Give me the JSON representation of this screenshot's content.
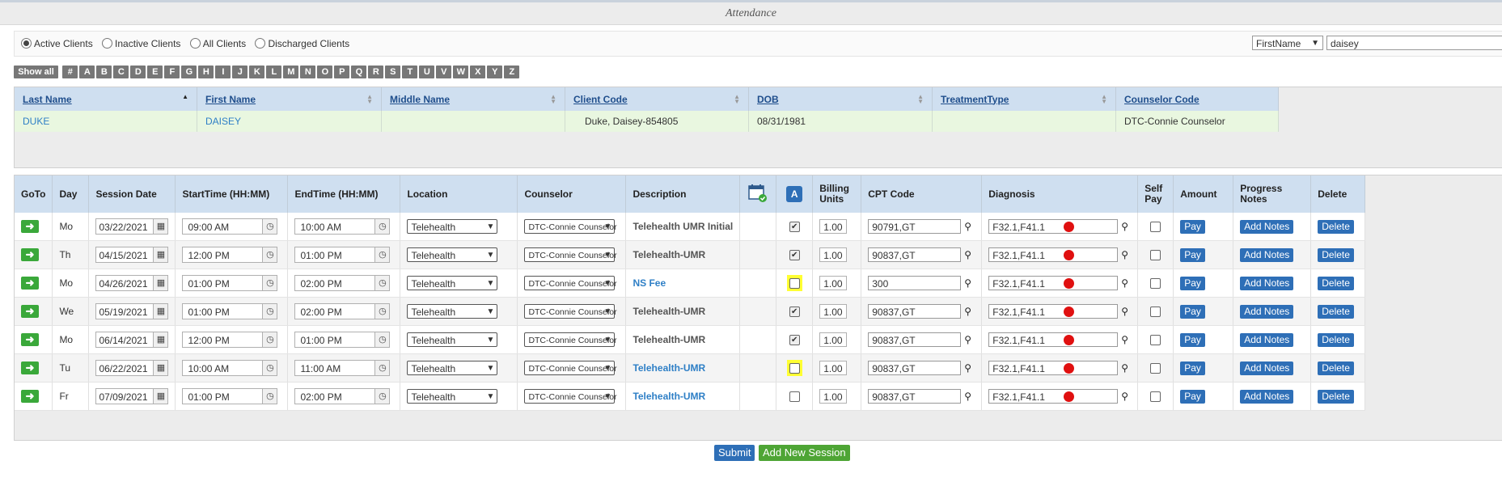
{
  "page": {
    "title": "Attendance"
  },
  "filters": {
    "radios": [
      {
        "label": "Active Clients",
        "checked": true
      },
      {
        "label": "Inactive Clients",
        "checked": false
      },
      {
        "label": "All Clients",
        "checked": false
      },
      {
        "label": "Discharged Clients",
        "checked": false
      }
    ],
    "search_field": "FirstName",
    "search_value": "daisey"
  },
  "alphabet": {
    "show_all": "Show all",
    "letters": [
      "#",
      "A",
      "B",
      "C",
      "D",
      "E",
      "F",
      "G",
      "H",
      "I",
      "J",
      "K",
      "L",
      "M",
      "N",
      "O",
      "P",
      "Q",
      "R",
      "S",
      "T",
      "U",
      "V",
      "W",
      "X",
      "Y",
      "Z"
    ]
  },
  "clients": {
    "headers": [
      "Last Name",
      "First Name",
      "Middle Name",
      "Client Code",
      "DOB",
      "TreatmentType",
      "Counselor Code"
    ],
    "rows": [
      {
        "last": "DUKE",
        "first": "DAISEY",
        "middle": "",
        "code": "Duke, Daisey-854805",
        "dob": "08/31/1981",
        "treatment": "",
        "counselor": "DTC-Connie Counselor"
      }
    ]
  },
  "sessions": {
    "headers": {
      "goto": "GoTo",
      "day": "Day",
      "date": "Session Date",
      "start": "StartTime (HH:MM)",
      "end": "EndTime (HH:MM)",
      "location": "Location",
      "counselor": "Counselor",
      "description": "Description",
      "attend": "A",
      "units_1": "Billing",
      "units_2": "Units",
      "cpt": "CPT Code",
      "diagnosis": "Diagnosis",
      "selfpay_1": "Self",
      "selfpay_2": "Pay",
      "amount": "Amount",
      "notes_1": "Progress",
      "notes_2": "Notes",
      "delete": "Delete"
    },
    "rows": [
      {
        "day": "Mo",
        "date": "03/22/2021",
        "start": "09:00 AM",
        "end": "10:00 AM",
        "location": "Telehealth",
        "counselor": "DTC-Connie Counselor",
        "description": "Telehealth UMR Initial",
        "desc_link": false,
        "attended": true,
        "highlight": false,
        "units": "1.00",
        "cpt": "90791,GT",
        "diagnosis": "F32.1,F41.1",
        "pay": "Pay",
        "notes": "Add Notes",
        "delete": "Delete"
      },
      {
        "day": "Th",
        "date": "04/15/2021",
        "start": "12:00 PM",
        "end": "01:00 PM",
        "location": "Telehealth",
        "counselor": "DTC-Connie Counselor",
        "description": "Telehealth-UMR",
        "desc_link": false,
        "attended": true,
        "highlight": false,
        "units": "1.00",
        "cpt": "90837,GT",
        "diagnosis": "F32.1,F41.1",
        "pay": "Pay",
        "notes": "Add Notes",
        "delete": "Delete"
      },
      {
        "day": "Mo",
        "date": "04/26/2021",
        "start": "01:00 PM",
        "end": "02:00 PM",
        "location": "Telehealth",
        "counselor": "DTC-Connie Counselor",
        "description": "NS Fee",
        "desc_link": true,
        "attended": false,
        "highlight": true,
        "units": "1.00",
        "cpt": "300",
        "diagnosis": "F32.1,F41.1",
        "pay": "Pay",
        "notes": "Add Notes",
        "delete": "Delete"
      },
      {
        "day": "We",
        "date": "05/19/2021",
        "start": "01:00 PM",
        "end": "02:00 PM",
        "location": "Telehealth",
        "counselor": "DTC-Connie Counselor",
        "description": "Telehealth-UMR",
        "desc_link": false,
        "attended": true,
        "highlight": false,
        "units": "1.00",
        "cpt": "90837,GT",
        "diagnosis": "F32.1,F41.1",
        "pay": "Pay",
        "notes": "Add Notes",
        "delete": "Delete"
      },
      {
        "day": "Mo",
        "date": "06/14/2021",
        "start": "12:00 PM",
        "end": "01:00 PM",
        "location": "Telehealth",
        "counselor": "DTC-Connie Counselor",
        "description": "Telehealth-UMR",
        "desc_link": false,
        "attended": true,
        "highlight": false,
        "units": "1.00",
        "cpt": "90837,GT",
        "diagnosis": "F32.1,F41.1",
        "pay": "Pay",
        "notes": "Add Notes",
        "delete": "Delete"
      },
      {
        "day": "Tu",
        "date": "06/22/2021",
        "start": "10:00 AM",
        "end": "11:00 AM",
        "location": "Telehealth",
        "counselor": "DTC-Connie Counselor",
        "description": "Telehealth-UMR",
        "desc_link": true,
        "attended": false,
        "highlight": true,
        "units": "1.00",
        "cpt": "90837,GT",
        "diagnosis": "F32.1,F41.1",
        "pay": "Pay",
        "notes": "Add Notes",
        "delete": "Delete"
      },
      {
        "day": "Fr",
        "date": "07/09/2021",
        "start": "01:00 PM",
        "end": "02:00 PM",
        "location": "Telehealth",
        "counselor": "DTC-Connie Counselor",
        "description": "Telehealth-UMR",
        "desc_link": true,
        "attended": false,
        "highlight": false,
        "units": "1.00",
        "cpt": "90837,GT",
        "diagnosis": "F32.1,F41.1",
        "pay": "Pay",
        "notes": "Add Notes",
        "delete": "Delete"
      }
    ]
  },
  "footer": {
    "submit": "Submit",
    "add_session": "Add New Session"
  },
  "colors": {
    "header_blue": "#cfdff0",
    "client_row": "#e9f7e0",
    "button_blue": "#2e6fb7",
    "go_green": "#3aa83a",
    "add_green": "#4ea535",
    "highlight_yellow": "#ffff33",
    "diag_red": "#e01010"
  }
}
